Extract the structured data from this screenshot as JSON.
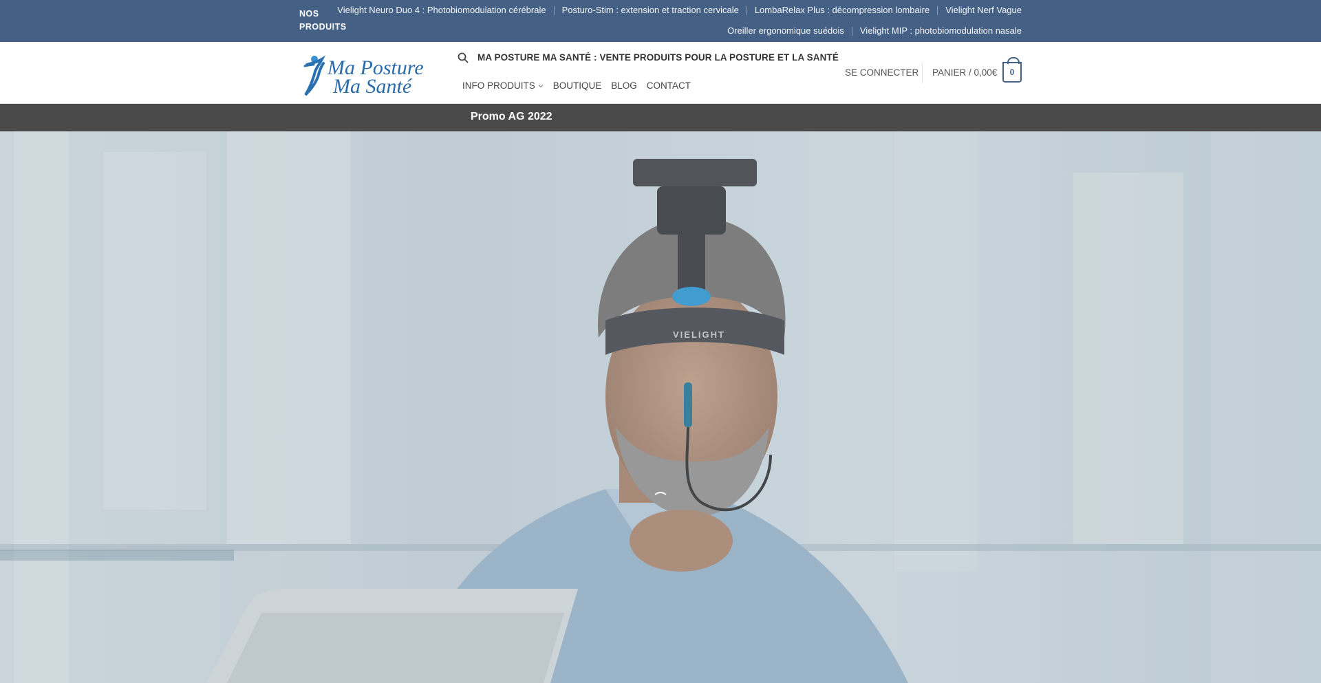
{
  "topbar": {
    "label": "NOS PRODUITS",
    "row1": [
      "Vielight Neuro Duo 4 : Photobiomodulation cérébrale",
      "Posturo-Stim : extension et traction cervicale",
      "LombaRelax Plus : décompression lombaire",
      "Vielight Nerf Vague"
    ],
    "row2": [
      "Oreiller ergonomique suédois",
      "Vielight MIP : photobiomodulation nasale"
    ],
    "bg_color": "#446084"
  },
  "header": {
    "logo_line1": "Ma Posture",
    "logo_line2": "Ma Santé",
    "site_title": "MA POSTURE MA SANTÉ : VENTE PRODUITS POUR LA POSTURE ET LA SANTÉ",
    "nav": [
      "INFO PRODUITS",
      "BOUTIQUE",
      "BLOG",
      "CONTACT"
    ],
    "login": "SE CONNECTER",
    "cart_label": "PANIER / 0,00€",
    "cart_count": "0",
    "search_icon": "search-icon"
  },
  "promo": {
    "text": "Promo AG 2022",
    "bg_color": "#4a4a4a"
  },
  "hero": {
    "device_label": "VIELIGHT",
    "loading": true
  }
}
